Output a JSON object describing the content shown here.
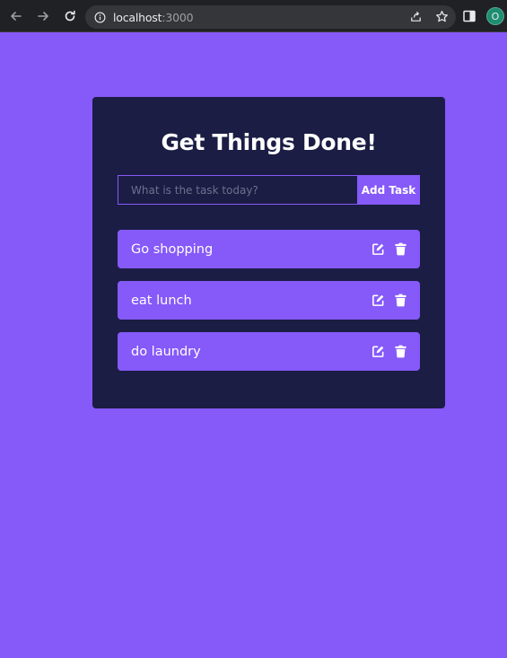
{
  "browser": {
    "url_host": "localhost",
    "url_port": ":3000",
    "profile_initial": "O"
  },
  "app": {
    "title": "Get Things Done!",
    "input_placeholder": "What is the task today?",
    "input_value": "",
    "add_button_label": "Add Task",
    "todos": [
      {
        "text": "Go shopping"
      },
      {
        "text": "eat lunch"
      },
      {
        "text": "do laundry"
      }
    ]
  },
  "colors": {
    "page_background": "#8659f9",
    "card_background": "#1b1d44",
    "accent": "#8659f9",
    "text": "#ffffff"
  },
  "icons": {
    "edit": "edit-icon",
    "delete": "trash-icon"
  }
}
